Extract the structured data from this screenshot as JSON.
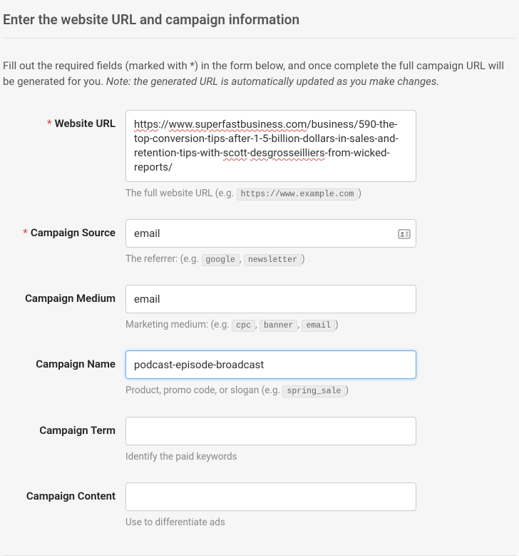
{
  "heading": "Enter the website URL and campaign information",
  "instructions_plain": "Fill out the required fields (marked with *) in the form below, and once complete the full campaign URL will be generated for you. ",
  "instructions_note": "Note: the generated URL is automatically updated as you make changes.",
  "fields": {
    "website_url": {
      "label": "Website URL",
      "required": true,
      "value": "https://www.superfastbusiness.com/business/590-the-top-conversion-tips-after-1-5-billion-dollars-in-sales-and-retention-tips-with-scott-desgrosseilliers-from-wicked-reports/",
      "value_part1": "https",
      "value_sep1": "://",
      "value_part2": "www.superfastbusiness.com",
      "value_rest1": "/business/590-the-top-conversion-tips-after-1-5-billion-dollars-in-sales-and-retention-tips-with-",
      "value_part3": "scott",
      "value_sep2": "-",
      "value_part4": "desgrosseilliers",
      "value_rest2": "-from-wicked-reports/",
      "help_prefix": "The full website URL (e.g. ",
      "help_code": "https://www.example.com",
      "help_suffix": ")"
    },
    "campaign_source": {
      "label": "Campaign Source",
      "required": true,
      "value": "email",
      "help_prefix": "The referrer: (e.g. ",
      "help_code1": "google",
      "help_sep": ", ",
      "help_code2": "newsletter",
      "help_suffix": ")"
    },
    "campaign_medium": {
      "label": "Campaign Medium",
      "required": false,
      "value": "email",
      "help_prefix": "Marketing medium: (e.g. ",
      "help_code1": "cpc",
      "help_sep": ", ",
      "help_code2": "banner",
      "help_code3": "email",
      "help_suffix": ")"
    },
    "campaign_name": {
      "label": "Campaign Name",
      "required": false,
      "value": "podcast-episode-broadcast",
      "help_prefix": "Product, promo code, or slogan (e.g. ",
      "help_code": "spring_sale",
      "help_suffix": ")"
    },
    "campaign_term": {
      "label": "Campaign Term",
      "required": false,
      "value": "",
      "help": "Identify the paid keywords"
    },
    "campaign_content": {
      "label": "Campaign Content",
      "required": false,
      "value": "",
      "help": "Use to differentiate ads"
    }
  }
}
